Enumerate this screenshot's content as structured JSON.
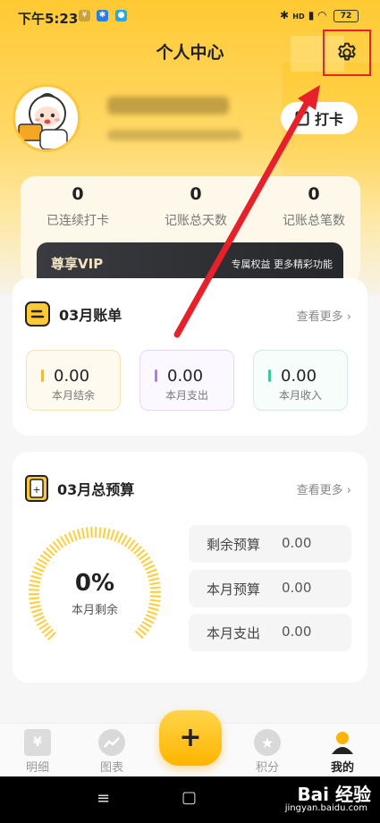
{
  "status_bar": {
    "time": "下午5:23",
    "badge_yen": "¥",
    "battery": "72",
    "network": "HD"
  },
  "header": {
    "title": "个人中心"
  },
  "profile": {
    "checkin_label": "打卡"
  },
  "stats": [
    {
      "value": "0",
      "label": "已连续打卡"
    },
    {
      "value": "0",
      "label": "记账总天数"
    },
    {
      "value": "0",
      "label": "记账总笔数"
    }
  ],
  "vip": {
    "title": "尊享VIP",
    "subtitle": "专属权益 更多精彩功能"
  },
  "bill": {
    "title": "03月账单",
    "more": "查看更多",
    "items": [
      {
        "value": "0.00",
        "label": "本月结余",
        "color": "#f5b93a",
        "bg": "#fffaf0",
        "border": "#f6e2b0"
      },
      {
        "value": "0.00",
        "label": "本月支出",
        "color": "#b27be8",
        "bg": "#fbf8ff",
        "border": "#e5d6f7"
      },
      {
        "value": "0.00",
        "label": "本月收入",
        "color": "#3cc99a",
        "bg": "#f6fdfa",
        "border": "#cfeee2"
      }
    ]
  },
  "budget": {
    "title": "03月总预算",
    "more": "查看更多",
    "percent": "0%",
    "percent_label": "本月剩余",
    "rows": [
      {
        "label": "剩余预算",
        "value": "0.00"
      },
      {
        "label": "本月预算",
        "value": "0.00"
      },
      {
        "label": "本月支出",
        "value": "0.00"
      }
    ]
  },
  "nav": {
    "items": [
      {
        "label": "明细"
      },
      {
        "label": "图表"
      },
      {
        "label": "积分"
      },
      {
        "label": "我的"
      }
    ],
    "fab_symbol": "+"
  },
  "system_nav": {
    "menu": "≡",
    "home": "▢"
  },
  "watermark": {
    "brand": "Bai 经验",
    "url": "jingyan.baidu.com"
  },
  "colors": {
    "accent": "#ffc933",
    "annotation_red": "#e8202a"
  }
}
